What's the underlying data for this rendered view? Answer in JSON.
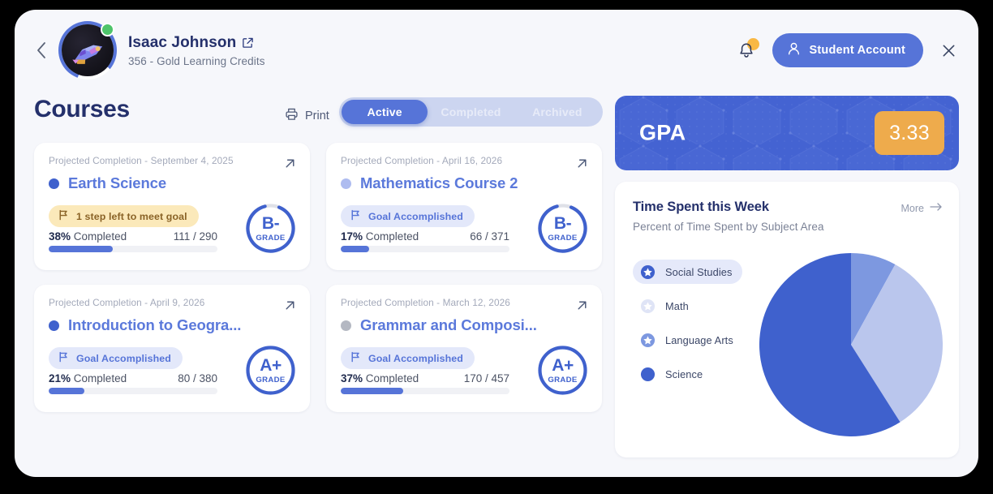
{
  "header": {
    "back_icon": "chevron-left-icon",
    "user_name": "Isaac Johnson",
    "external_link_icon": "external-link-icon",
    "credits": "356 - Gold Learning Credits",
    "avatar_icon": "rocket-avatar",
    "status_indicator": "online-dot",
    "bell_icon": "notification-bell-icon",
    "account_icon": "user-icon",
    "account_label": "Student Account",
    "close_icon": "close-icon"
  },
  "courses_section": {
    "title": "Courses",
    "print_icon": "printer-icon",
    "print_label": "Print",
    "tabs": [
      {
        "label": "Active",
        "active": true
      },
      {
        "label": "Completed",
        "active": false
      },
      {
        "label": "Archived",
        "active": false
      }
    ],
    "cards": [
      {
        "date": "Projected Completion - September 4, 2025",
        "title": "Earth Science",
        "dot_color": "#3f61cd",
        "badge_text": "1 step left to meet goal",
        "badge_type": "warn",
        "percent": "38%",
        "completed_label": "Completed",
        "count": "111 / 290",
        "progress": 38,
        "grade": "B-",
        "grade_word": "GRADE",
        "grade_complete": false,
        "open_icon": "arrow-up-right-icon",
        "flag_icon": "flag-icon"
      },
      {
        "date": "Projected Completion - April 16, 2026",
        "title": "Mathematics Course 2",
        "dot_color": "#aebcf0",
        "badge_text": "Goal Accomplished",
        "badge_type": "done",
        "percent": "17%",
        "completed_label": "Completed",
        "count": "66 / 371",
        "progress": 17,
        "grade": "B-",
        "grade_word": "GRADE",
        "grade_complete": false,
        "open_icon": "arrow-up-right-icon",
        "flag_icon": "flag-icon"
      },
      {
        "date": "Projected Completion - April 9, 2026",
        "title": "Introduction to Geogra...",
        "dot_color": "#3f61cd",
        "badge_text": "Goal Accomplished",
        "badge_type": "done",
        "percent": "21%",
        "completed_label": "Completed",
        "count": "80 / 380",
        "progress": 21,
        "grade": "A+",
        "grade_word": "GRADE",
        "grade_complete": true,
        "open_icon": "arrow-up-right-icon",
        "flag_icon": "flag-icon"
      },
      {
        "date": "Projected Completion - March 12, 2026",
        "title": "Grammar and Composi...",
        "dot_color": "#b4b8c2",
        "badge_text": "Goal Accomplished",
        "badge_type": "done",
        "percent": "37%",
        "completed_label": "Completed",
        "count": "170 / 457",
        "progress": 37,
        "grade": "A+",
        "grade_word": "GRADE",
        "grade_complete": true,
        "open_icon": "arrow-up-right-icon",
        "flag_icon": "flag-icon"
      }
    ]
  },
  "gpa": {
    "label": "GPA",
    "value": "3.33",
    "banner_color": "#4463d2",
    "value_color": "#eeab4c"
  },
  "time_panel": {
    "title": "Time Spent this Week",
    "subtitle": "Percent of Time Spent by Subject Area",
    "more_label": "More",
    "more_icon": "arrow-right-icon"
  },
  "chart_data": {
    "type": "pie",
    "title": "Time Spent this Week",
    "subtitle": "Percent of Time Spent by Subject Area",
    "legend_position": "left",
    "categories": [
      "Social Studies",
      "Math",
      "Language Arts",
      "Science"
    ],
    "values": [
      59,
      0,
      33,
      8
    ],
    "colors": [
      "#3f61cd",
      "#dfe4f6",
      "#bac6ed",
      "#7d98e0"
    ],
    "legend": [
      {
        "label": "Social Studies",
        "marker": "star-badge-icon",
        "color": "#3f61cd",
        "selected": true
      },
      {
        "label": "Math",
        "marker": "star-badge-icon",
        "color": "#dfe4f6",
        "selected": false
      },
      {
        "label": "Language Arts",
        "marker": "star-badge-icon",
        "color": "#7d98e0",
        "selected": false
      },
      {
        "label": "Science",
        "marker": "dot-icon",
        "color": "#3f61cd",
        "selected": false
      }
    ]
  }
}
